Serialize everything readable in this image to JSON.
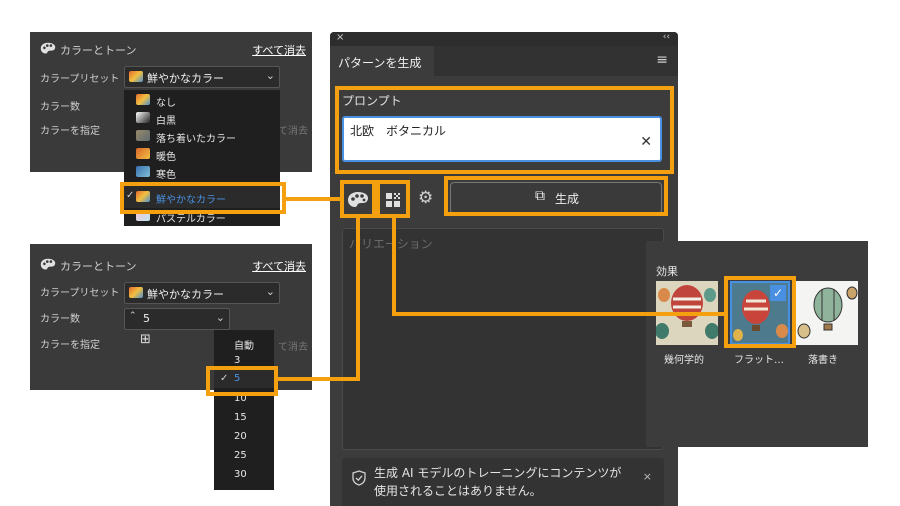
{
  "tone1": {
    "header": "カラーとトーン",
    "clear_all": "すべて消去",
    "preset_label": "カラープリセット",
    "preset_value": "鮮やかなカラー",
    "count_label": "カラー数",
    "specify_label": "カラーを指定",
    "ghost_clear": "て消去",
    "menu": [
      "なし",
      "白黒",
      "落ち着いたカラー",
      "暖色",
      "寒色",
      "鮮やかなカラー",
      "パステルカラー"
    ],
    "checkmark": "✓"
  },
  "tone2": {
    "header": "カラーとトーン",
    "clear_all": "すべて消去",
    "preset_label": "カラープリセット",
    "preset_value": "鮮やかなカラー",
    "count_label": "カラー数",
    "count_value": "5",
    "specify_label": "カラーを指定",
    "ghost_clear": "て消去",
    "menu": [
      "自動",
      "3",
      "5",
      "10",
      "15",
      "20",
      "25",
      "30"
    ],
    "checkmark": "✓"
  },
  "main": {
    "title": "パターンを生成",
    "prompt_label": "プロンプト",
    "prompt_value": "北欧　ボタニカル",
    "generate_label": "生成",
    "variations_placeholder": "バリエーション",
    "notice": "生成 AI モデルのトレーニングにコンテンツが使用されることはありません。"
  },
  "effects": {
    "title": "効果",
    "items": [
      "幾何学的",
      "フラット…",
      "落書き"
    ]
  },
  "colors": {
    "accent": "#f5a00f",
    "panel": "#3a3a3a",
    "select_blue": "#4a90e2"
  },
  "icons": [
    "palette-icon",
    "pattern-grid-icon",
    "gear-icon",
    "generate-sparkle-icon",
    "shield-icon",
    "close-icon",
    "menu-icon",
    "chevron-down-icon",
    "stepper-icon",
    "plus-icon",
    "check-icon"
  ]
}
